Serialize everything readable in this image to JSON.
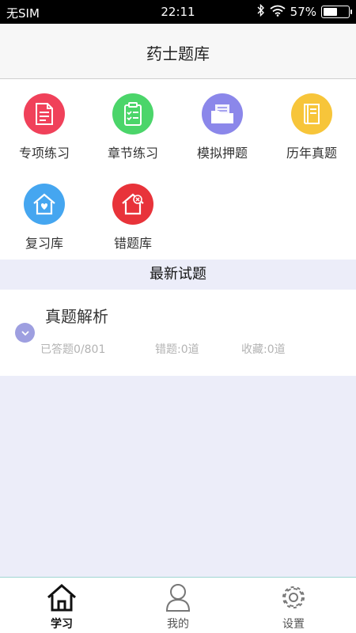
{
  "status_bar": {
    "carrier": "无SIM",
    "time": "22:11",
    "battery": "57%",
    "battery_level": 0.57
  },
  "header": {
    "title": "药士题库"
  },
  "grid": {
    "items": [
      {
        "label": "专项练习",
        "icon": "document-icon",
        "color": "#f0415a"
      },
      {
        "label": "章节练习",
        "icon": "clipboard-checklist-icon",
        "color": "#4bd56a"
      },
      {
        "label": "模拟押题",
        "icon": "folder-documents-icon",
        "color": "#8b87ea"
      },
      {
        "label": "历年真题",
        "icon": "book-icon",
        "color": "#f7c53a"
      },
      {
        "label": "复习库",
        "icon": "home-heart-icon",
        "color": "#45a6f0"
      },
      {
        "label": "错题库",
        "icon": "home-x-icon",
        "color": "#e8333a"
      }
    ]
  },
  "section": {
    "title": "最新试题"
  },
  "card": {
    "title": "真题解析",
    "answered": "已答题0/801",
    "wrong": "错题:0道",
    "favorites": "收藏:0道"
  },
  "tabbar": {
    "tabs": [
      {
        "label": "学习",
        "active": true
      },
      {
        "label": "我的"
      },
      {
        "label": "设置"
      }
    ]
  },
  "colors": {
    "accent_purple": "#9e9fe0",
    "tab_divider": "#9fd6d3",
    "background": "#ecedf9"
  }
}
